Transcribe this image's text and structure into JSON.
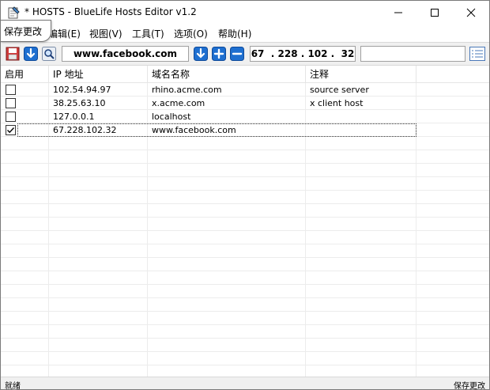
{
  "window": {
    "title": "* HOSTS - BlueLife Hosts Editor v1.2"
  },
  "tooltip": {
    "text": "保存更改"
  },
  "menu": {
    "items": [
      {
        "label": "编辑(E)"
      },
      {
        "label": "视图(V)"
      },
      {
        "label": "工具(T)"
      },
      {
        "label": "选项(O)"
      },
      {
        "label": "帮助(H)"
      }
    ]
  },
  "toolbar": {
    "domain_value": "www.facebook.com",
    "ip_value": "67  . 228 . 102 .  32",
    "comment_value": ""
  },
  "table": {
    "columns": [
      "启用",
      "IP 地址",
      "域名名称",
      "注释"
    ],
    "rows": [
      {
        "enabled": false,
        "ip": "102.54.94.97",
        "domain": "rhino.acme.com",
        "comment": "source server"
      },
      {
        "enabled": false,
        "ip": "38.25.63.10",
        "domain": "x.acme.com",
        "comment": "x client host"
      },
      {
        "enabled": false,
        "ip": "127.0.0.1",
        "domain": "localhost",
        "comment": ""
      },
      {
        "enabled": true,
        "ip": "67.228.102.32",
        "domain": "www.facebook.com",
        "comment": ""
      }
    ]
  },
  "status": {
    "left": "就绪",
    "right": "保存更改"
  },
  "colors": {
    "accent_blue": "#1e6fd0",
    "toolbar_bg": "#f0f0f0",
    "save_red": "#d23b3b"
  }
}
